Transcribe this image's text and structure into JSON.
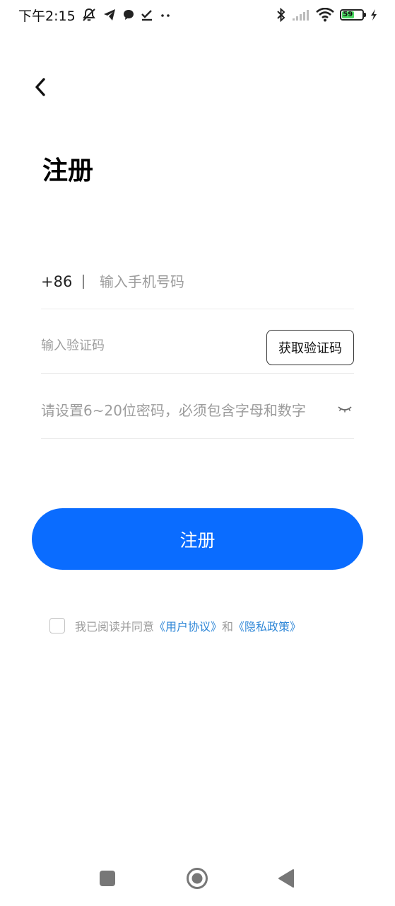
{
  "status_bar": {
    "time": "下午2:15",
    "left_icons": [
      "mute-bell-icon",
      "telegram-icon",
      "chat-bubble-icon",
      "check-icon",
      "more-dots-icon"
    ],
    "right_icons": [
      "bluetooth-icon",
      "signal-icon",
      "wifi-icon",
      "battery-icon",
      "charging-icon"
    ],
    "battery_level": "59",
    "battery_percent": 59
  },
  "header": {
    "back_icon": "chevron-left-icon",
    "title": "注册"
  },
  "form": {
    "country_code": "+86",
    "phone_placeholder": "输入手机号码",
    "code_placeholder": "输入验证码",
    "get_code_label": "获取验证码",
    "password_placeholder": "请设置6~20位密码，必须包含字母和数字",
    "password_toggle_icon": "eye-closed-icon"
  },
  "submit": {
    "label": "注册"
  },
  "agreement": {
    "prefix": "我已阅读并同意",
    "user_agreement": "《用户协议》",
    "conjunction": "和",
    "privacy_policy": "《隐私政策》",
    "checked": false
  },
  "navigation": {
    "recent_icon": "square-icon",
    "home_icon": "circle-home-icon",
    "back_icon": "triangle-back-icon"
  },
  "colors": {
    "primary": "#0a6cff",
    "link": "#2f87d7",
    "placeholder": "#9c9c9c",
    "battery": "#4cd964"
  }
}
